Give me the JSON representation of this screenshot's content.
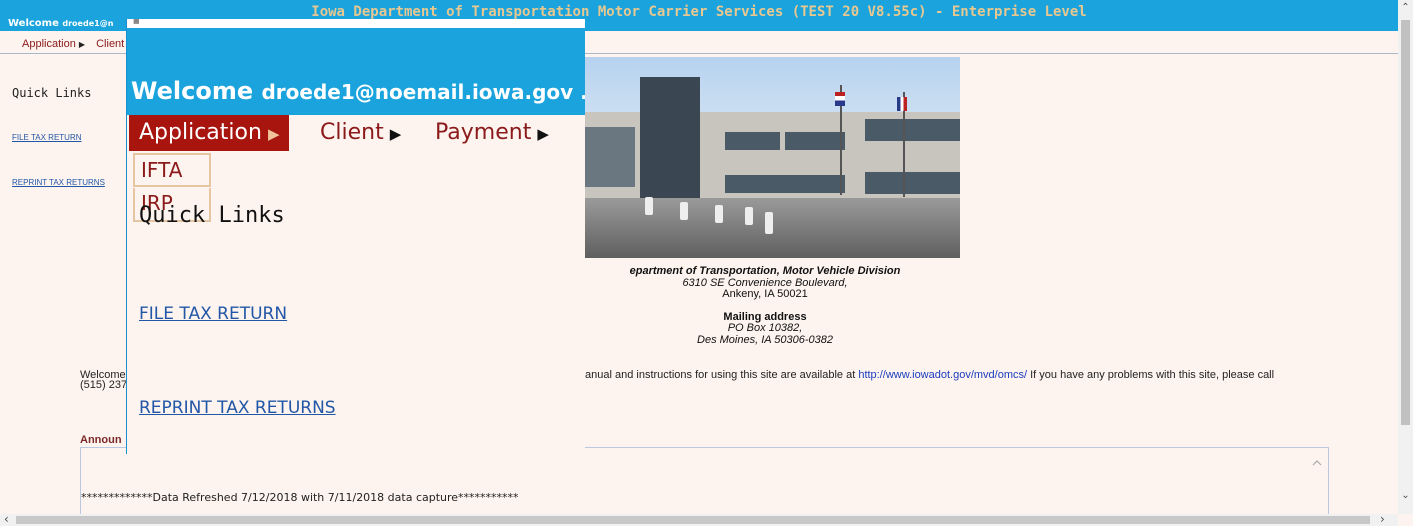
{
  "window": {
    "title": "Iowa Department of Transportation Motor Carrier Services (TEST 20 V8.55c) - Enterprise Level",
    "welcome_prefix": "Welcome",
    "welcome_email_truncated": "droede1@n"
  },
  "menu": {
    "items": [
      {
        "label": "Application"
      },
      {
        "label": "Client"
      },
      {
        "label": "Payment"
      }
    ],
    "caret": "▶",
    "submenu": [
      "IFTA",
      "IRP"
    ]
  },
  "sidebar": {
    "title": "Quick Links",
    "links": [
      "FILE TAX RETURN",
      "REPRINT TAX RETURNS"
    ]
  },
  "zoom": {
    "welcome_prefix": "Welcome",
    "welcome_email": "droede1@noemail.iowa.gov ."
  },
  "address": {
    "org": "epartment of Transportation, Motor Vehicle Division",
    "street": "6310 SE Convenience Boulevard,",
    "city": "Ankeny, IA 50021",
    "mailing_label": "Mailing address",
    "po": "PO Box 10382,",
    "po_city": "Des Moines, IA 50306-0382"
  },
  "welcome_text": {
    "start": "Welcome",
    "phone": "(515) 237",
    "right_before": "anual and instructions for using this site are available at ",
    "link": "http://www.iowadot.gov/mvd/omcs/",
    "right_after": " If you have any problems with this site, please call"
  },
  "announcements": {
    "label": "Announ",
    "text": "*************Data Refreshed 7/12/2018 with 7/11/2018 data capture***********"
  },
  "colors": {
    "header": "#1aa3dc",
    "menu_active": "#a8150e",
    "menu_text": "#8b1a1a",
    "link": "#2157a6",
    "background": "#fdf3ef"
  }
}
